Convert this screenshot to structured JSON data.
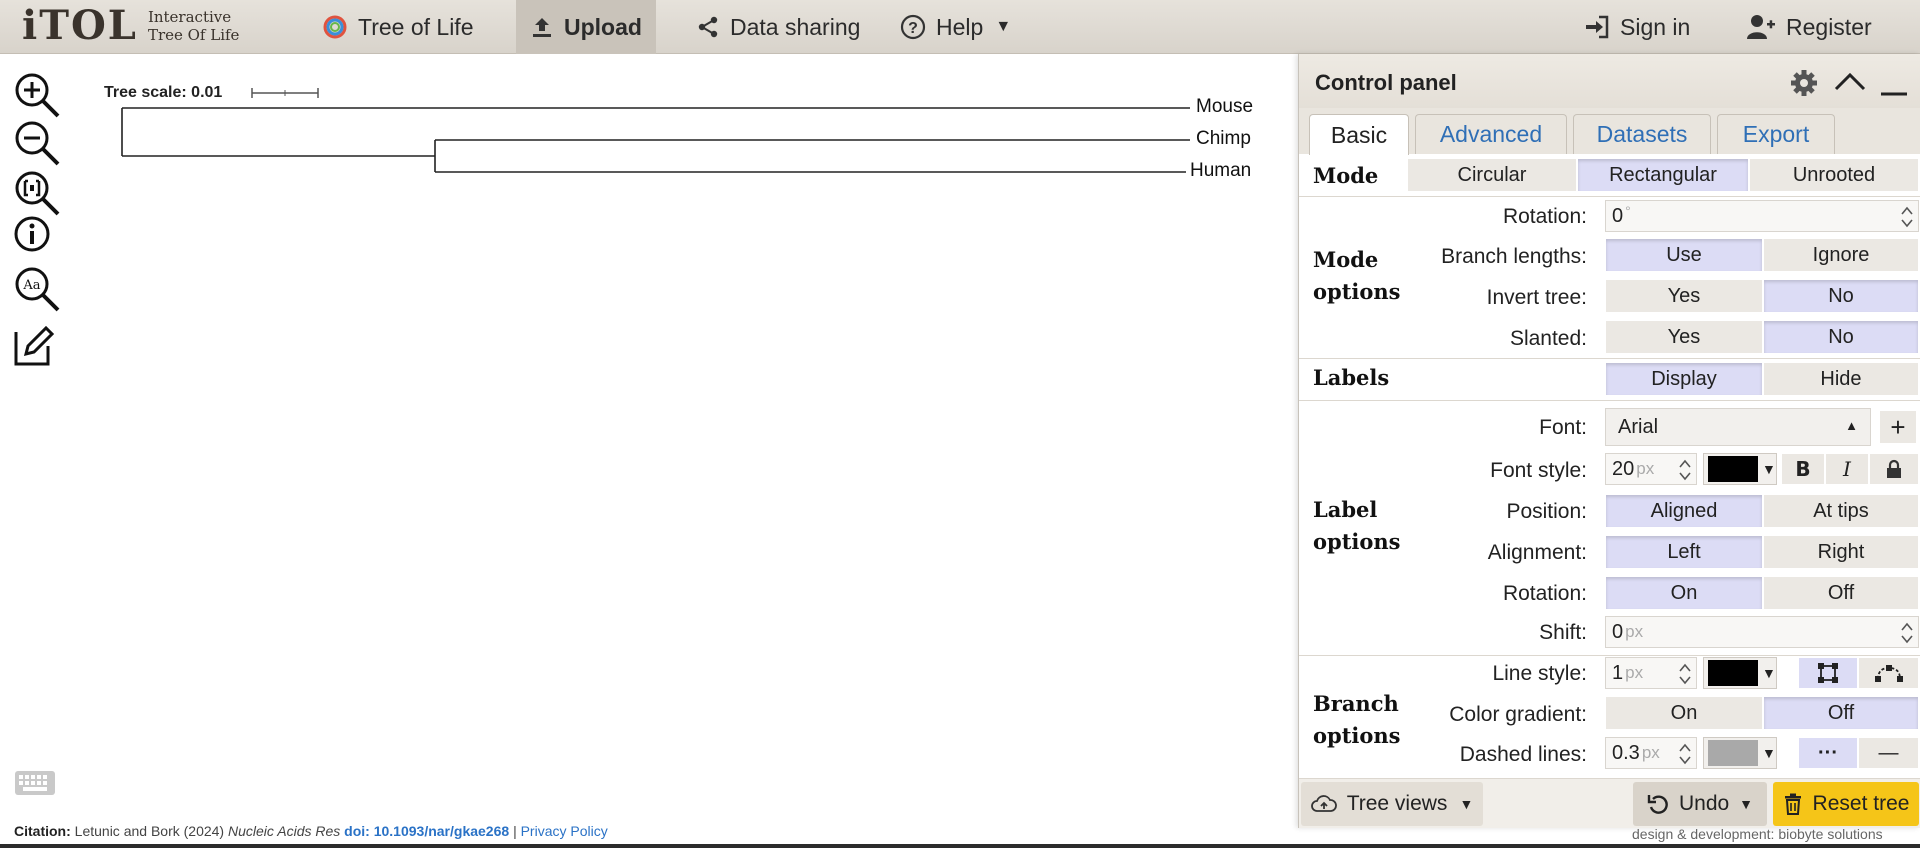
{
  "logo": {
    "main": "iTOL",
    "sub1": "Interactive",
    "sub2": "Tree Of Life"
  },
  "nav": {
    "tree_of_life": "Tree of Life",
    "upload": "Upload",
    "data_sharing": "Data sharing",
    "help": "Help",
    "sign_in": "Sign in",
    "register": "Register"
  },
  "tree": {
    "scale_label": "Tree scale: 0.01",
    "leaves": [
      "Mouse",
      "Chimp",
      "Human"
    ]
  },
  "control_panel": {
    "title": "Control panel",
    "tabs": [
      "Basic",
      "Advanced",
      "Datasets",
      "Export"
    ],
    "active_tab": "Basic",
    "mode": {
      "label": "Mode",
      "options": [
        "Circular",
        "Rectangular",
        "Unrooted"
      ],
      "selected": "Rectangular"
    },
    "mode_options": {
      "label_line1": "Mode",
      "label_line2": "options",
      "rotation_label": "Rotation:",
      "rotation_value": "0",
      "rotation_unit": "°",
      "branch_lengths_label": "Branch lengths:",
      "branch_lengths_options": [
        "Use",
        "Ignore"
      ],
      "invert_label": "Invert tree:",
      "invert_options": [
        "Yes",
        "No"
      ],
      "slanted_label": "Slanted:",
      "slanted_options": [
        "Yes",
        "No"
      ]
    },
    "labels": {
      "label": "Labels",
      "options": [
        "Display",
        "Hide"
      ]
    },
    "label_options": {
      "label_line1": "Label",
      "label_line2": "options",
      "font_label": "Font:",
      "font_value": "Arial",
      "font_add": "+",
      "font_style_label": "Font style:",
      "font_size": "20",
      "unit": "px",
      "bold": "B",
      "italic": "I",
      "position_label": "Position:",
      "position_options": [
        "Aligned",
        "At tips"
      ],
      "alignment_label": "Alignment:",
      "alignment_options": [
        "Left",
        "Right"
      ],
      "rotation_label": "Rotation:",
      "rotation_options": [
        "On",
        "Off"
      ],
      "shift_label": "Shift:",
      "shift_value": "0"
    },
    "branch_options": {
      "label_line1": "Branch",
      "label_line2": "options",
      "line_style_label": "Line style:",
      "line_width": "1",
      "color_gradient_label": "Color gradient:",
      "color_gradient_options": [
        "On",
        "Off"
      ],
      "dashed_label": "Dashed lines:",
      "dashed_value": "0.3",
      "dashed_dots": "···",
      "dashed_solid": "—"
    },
    "footer": {
      "tree_views": "Tree views",
      "undo": "Undo",
      "reset": "Reset tree"
    }
  },
  "citation": {
    "prefix": "Citation:",
    "authors": "Letunic and Bork (2024)",
    "journal": "Nucleic Acids Res",
    "doi": "doi: 10.1093/nar/gkae268",
    "separator": "|",
    "privacy": "Privacy Policy"
  },
  "credit": "design & development: biobyte solutions",
  "colors": {
    "accent_blue": "#2f6fb6",
    "selected_segment": "#dcdcf5",
    "reset_yellow": "#f5c518",
    "label_color": "#000000",
    "dashed_color": "#a9a9a9"
  }
}
